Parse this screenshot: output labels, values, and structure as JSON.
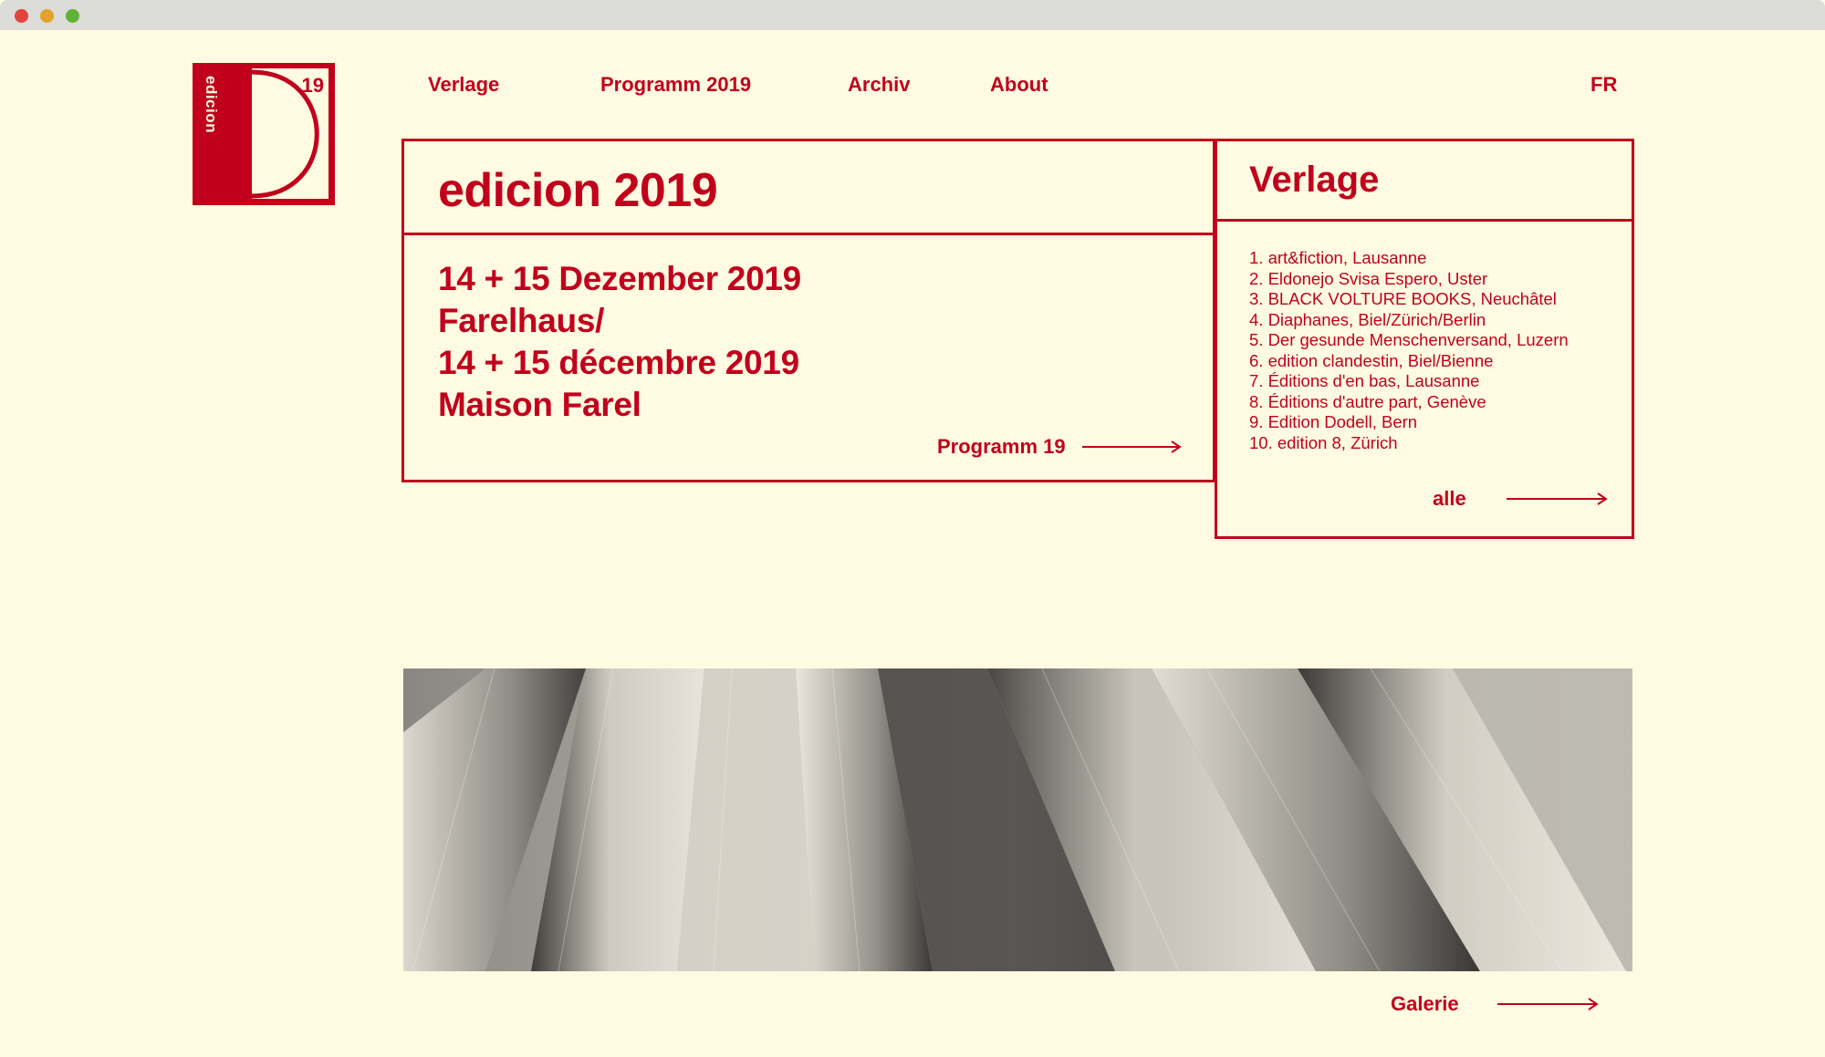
{
  "logo": {
    "word": "edicion",
    "number": "19"
  },
  "nav": {
    "verlage": "Verlage",
    "programm": "Programm 2019",
    "archiv": "Archiv",
    "about": "About",
    "lang": "FR"
  },
  "edition": {
    "title": "edicion 2019",
    "lines": [
      "14 + 15 Dezember 2019",
      "Farelhaus/",
      "14 + 15 décembre 2019",
      "Maison Farel"
    ],
    "program_link": "Programm 19"
  },
  "verlage": {
    "title": "Verlage",
    "items": [
      "1. art&fiction, Lausanne",
      "2. Eldonejo Svisa Espero, Uster",
      "3. BLACK VOLTURE BOOKS, Neuchâtel",
      "4. Diaphanes, Biel/Zürich/Berlin",
      "5. Der gesunde Menschenversand, Luzern",
      "6. edition clandestin, Biel/Bienne",
      "7. Éditions d'en bas, Lausanne",
      "8. Éditions d'autre part, Genève",
      "9. Edition Dodell, Bern",
      "10. edition 8, Zürich"
    ],
    "all_link": "alle"
  },
  "gallery": {
    "link": "Galerie"
  },
  "colors": {
    "accent": "#c1001c",
    "background": "#fffbe2"
  }
}
